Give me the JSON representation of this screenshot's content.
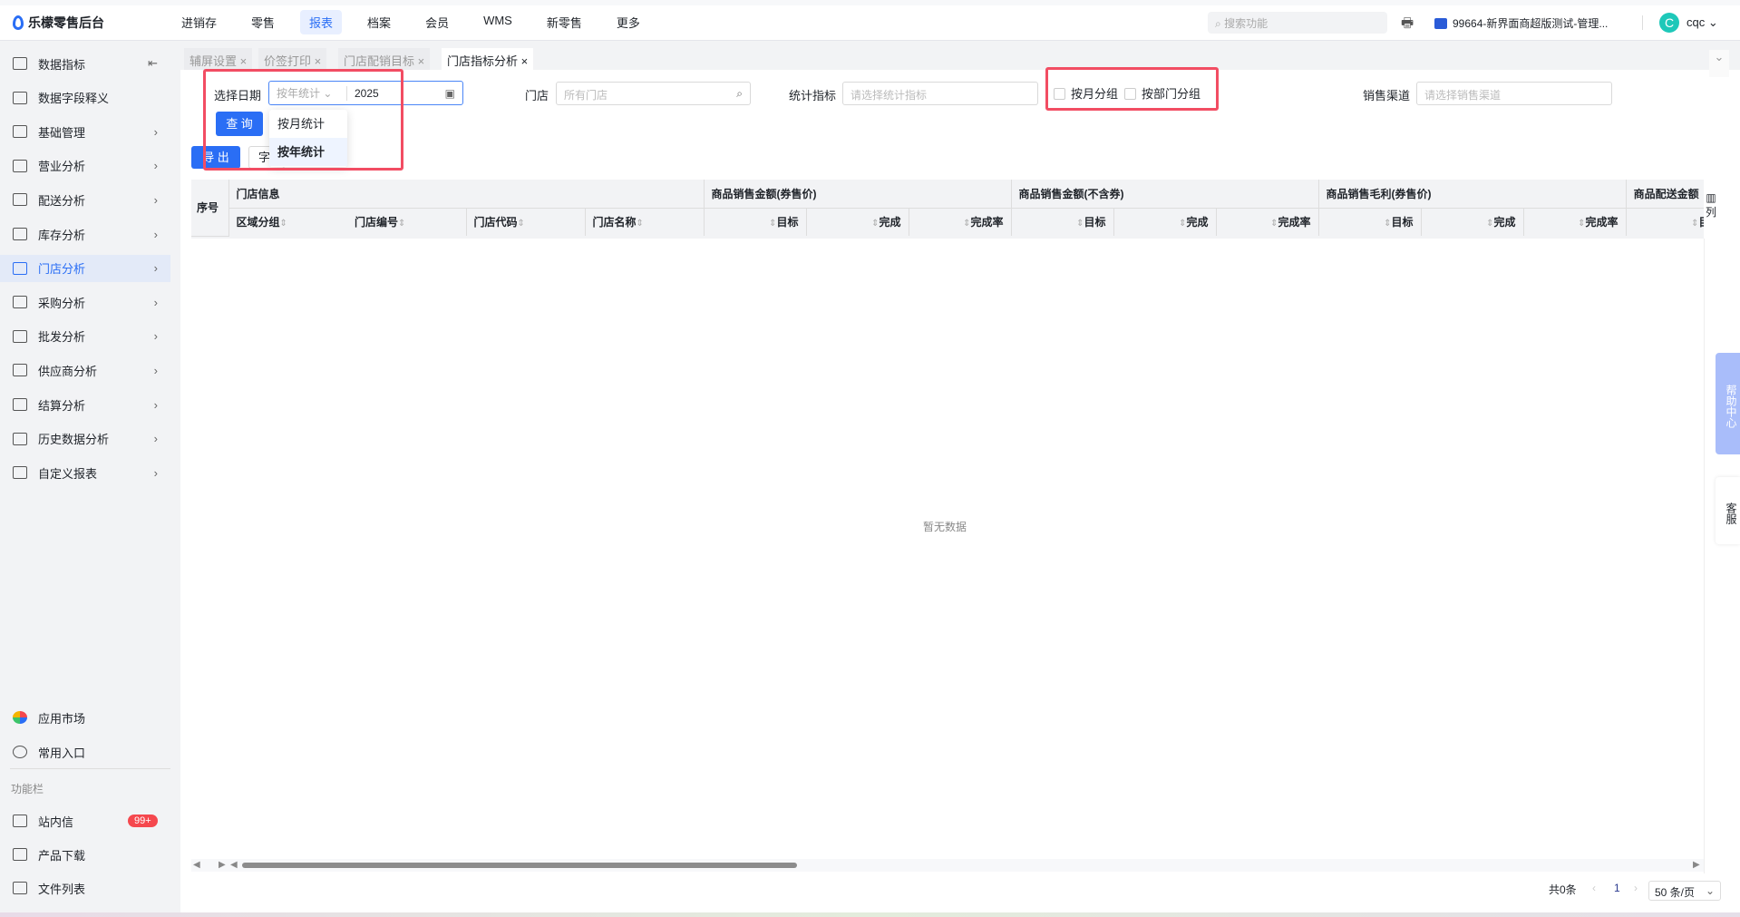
{
  "app": {
    "title": "乐檬零售后台"
  },
  "nav": [
    "进销存",
    "零售",
    "报表",
    "档案",
    "会员",
    "WMS",
    "新零售",
    "更多"
  ],
  "nav_active": 2,
  "top": {
    "search_placeholder": "搜索功能",
    "org": "99664-新界面商超版测试-管理...",
    "avatar": "C",
    "user": "cqc"
  },
  "sidebar": {
    "items": [
      {
        "label": "数据指标"
      },
      {
        "label": "数据字段释义"
      },
      {
        "label": "基础管理"
      },
      {
        "label": "营业分析"
      },
      {
        "label": "配送分析"
      },
      {
        "label": "库存分析"
      },
      {
        "label": "门店分析"
      },
      {
        "label": "采购分析"
      },
      {
        "label": "批发分析"
      },
      {
        "label": "供应商分析"
      },
      {
        "label": "结算分析"
      },
      {
        "label": "历史数据分析"
      },
      {
        "label": "自定义报表"
      }
    ],
    "active": 6,
    "bottom": [
      {
        "label": "应用市场"
      },
      {
        "label": "常用入口"
      }
    ],
    "section": "功能栏",
    "tools": [
      {
        "label": "站内信",
        "badge": "99+"
      },
      {
        "label": "产品下载"
      },
      {
        "label": "文件列表"
      }
    ]
  },
  "tabs": [
    {
      "label": "辅屏设置"
    },
    {
      "label": "价签打印"
    },
    {
      "label": "门店配销目标"
    },
    {
      "label": "门店指标分析"
    }
  ],
  "filters": {
    "date_label": "选择日期",
    "date_mode": "按年统计",
    "date_value": "2025",
    "store_label": "门店",
    "store_placeholder": "所有门店",
    "metric_label": "统计指标",
    "metric_placeholder": "请选择统计指标",
    "group_month": "按月分组",
    "group_dept": "按部门分组",
    "channel_label": "销售渠道",
    "channel_placeholder": "请选择销售渠道",
    "query": "查 询",
    "export": "导 出",
    "field_btn": "字",
    "dropdown": [
      "按月统计",
      "按年统计"
    ]
  },
  "table": {
    "seq": "序号",
    "info_group": "门店信息",
    "info_cols": [
      "区域分组",
      "门店编号",
      "门店代码",
      "门店名称"
    ],
    "groups": [
      "商品销售金额(券售价)",
      "商品销售金额(不含券)",
      "商品销售毛利(券售价)",
      "商品配送金额"
    ],
    "metric_cols": [
      "目标",
      "完成",
      "完成率"
    ],
    "col_setting": "列",
    "empty": "暂无数据"
  },
  "pagination": {
    "total": "共0条",
    "page": "1",
    "page_size": "50 条/页"
  },
  "float": {
    "help": "帮助中心",
    "service": "客服"
  }
}
